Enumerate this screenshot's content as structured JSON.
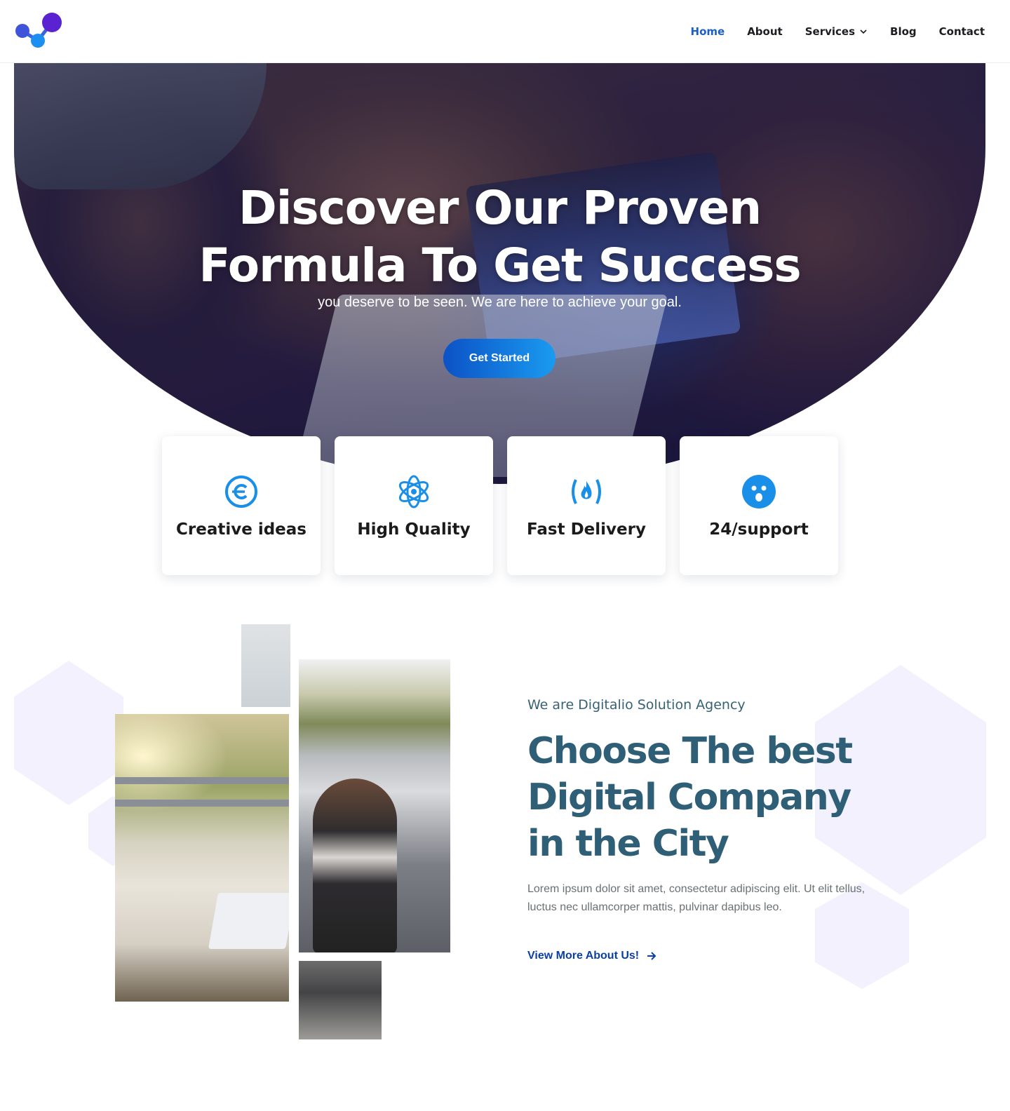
{
  "brand": {
    "logo_icon": "molecule-logo-icon",
    "colors": {
      "blue": "#1c5fc4",
      "purple": "#5c1fcf",
      "cyan": "#1a9bf0"
    }
  },
  "nav": {
    "items": [
      {
        "label": "Home",
        "active": true
      },
      {
        "label": "About"
      },
      {
        "label": "Services",
        "has_dropdown": true
      },
      {
        "label": "Blog"
      },
      {
        "label": "Contact"
      }
    ]
  },
  "hero": {
    "title_line1": "Discover Our Proven",
    "title_line2": "Formula To Get Success",
    "subtitle": "you deserve to be seen. We are here to achieve your goal.",
    "cta_label": "Get Started"
  },
  "features": [
    {
      "label": "Creative ideas",
      "icon": "creative-commons-icon"
    },
    {
      "label": "High Quality",
      "icon": "atom-icon"
    },
    {
      "label": "Fast Delivery",
      "icon": "fire-code-icon"
    },
    {
      "label": "24/support",
      "icon": "surprised-face-icon"
    }
  ],
  "about": {
    "tagline": "We are Digitalio Solution Agency",
    "title": "Choose The best Digital Company in the City",
    "body": "Lorem ipsum dolor sit amet, consectetur adipiscing elit. Ut elit tellus, luctus nec ullamcorper mattis, pulvinar dapibus leo.",
    "link_label": "View More About Us!"
  }
}
